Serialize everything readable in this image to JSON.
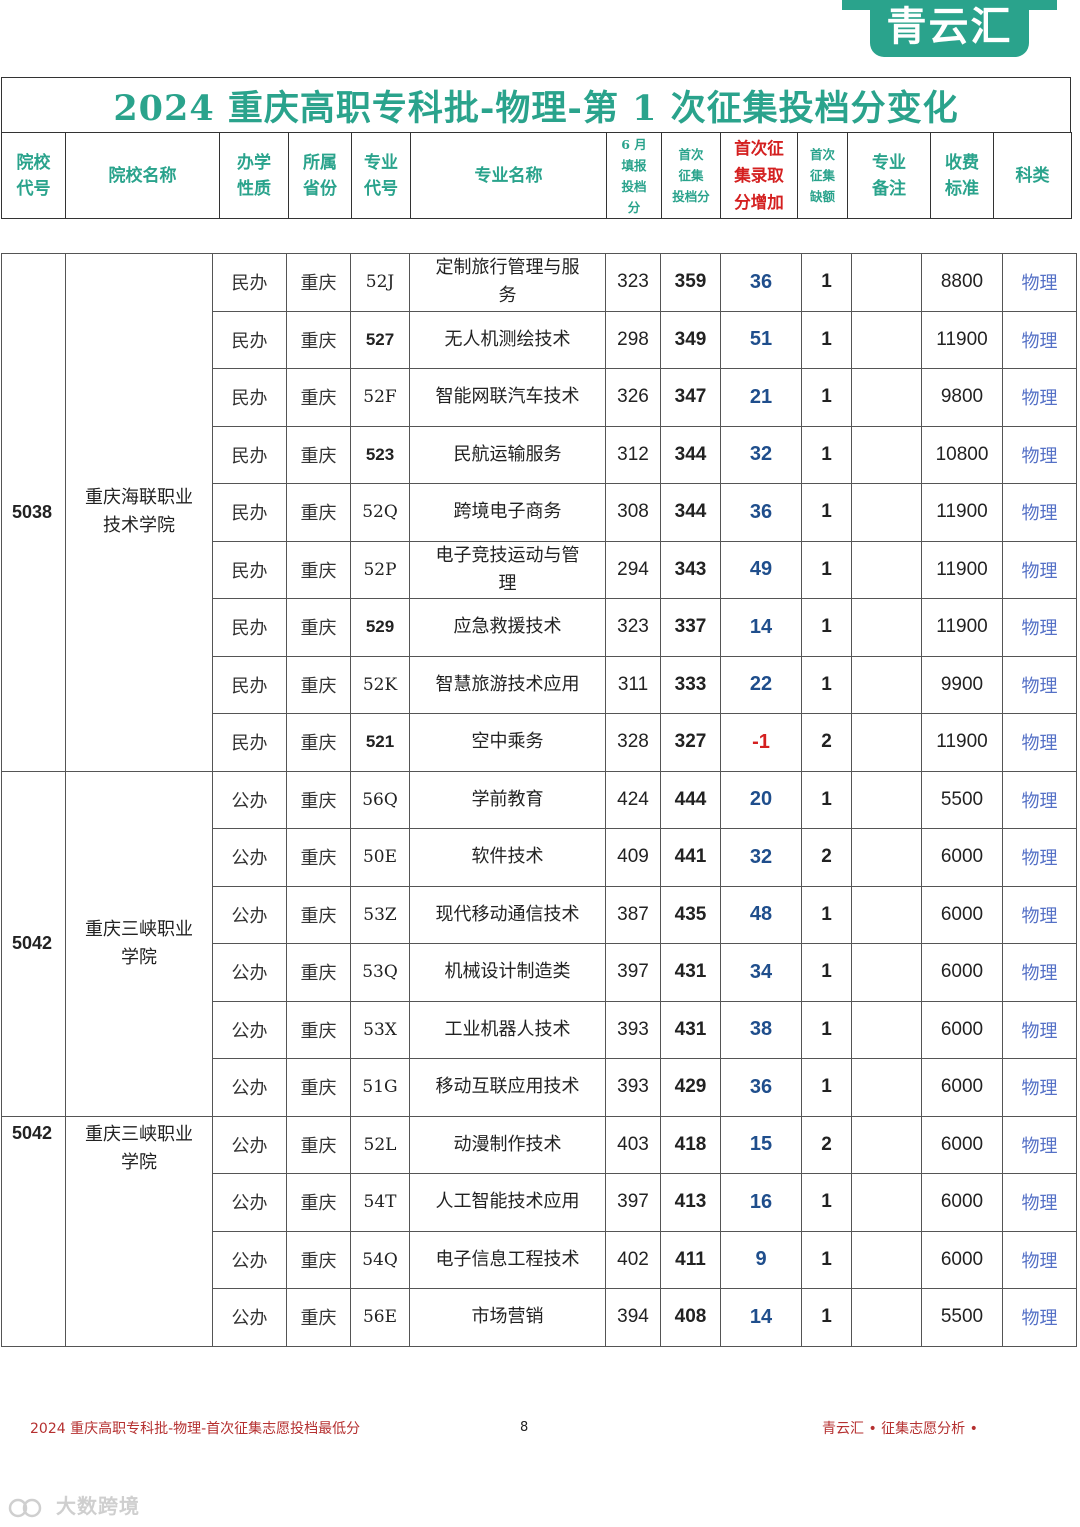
{
  "logo": {
    "text": "青云汇"
  },
  "title": "2024 重庆高职专科批-物理-第 1 次征集投档分变化",
  "colors": {
    "accent": "#2aa38c",
    "highlight_red": "#d42020",
    "increase_blue": "#1f4e8c",
    "category_blue": "#5470c6"
  },
  "header": [
    {
      "text": "院校\n代号",
      "style": "normal"
    },
    {
      "text": "院校名称",
      "style": "normal"
    },
    {
      "text": "办学\n性质",
      "style": "normal"
    },
    {
      "text": "所属\n省份",
      "style": "normal"
    },
    {
      "text": "专业\n代号",
      "style": "normal"
    },
    {
      "text": "专业名称",
      "style": "normal"
    },
    {
      "text": "6 月\n填报\n投档\n分",
      "style": "small"
    },
    {
      "text": "首次\n征集\n投档分",
      "style": "small"
    },
    {
      "text": "首次征\n集录取\n分增加",
      "style": "red"
    },
    {
      "text": "首次\n征集\n缺额",
      "style": "small"
    },
    {
      "text": "专业\n备注",
      "style": "normal"
    },
    {
      "text": "收费\n标准",
      "style": "normal"
    },
    {
      "text": "科类",
      "style": "normal"
    }
  ],
  "groups": [
    {
      "school_code": "5038",
      "school_name": "重庆海联职业\n技术学院",
      "align": "middle",
      "rows": [
        {
          "nature": "民办",
          "province": "重庆",
          "major_code": "52J",
          "bold_code": false,
          "major_name": "定制旅行管理与服\n务",
          "june_score": "323",
          "first_score": "359",
          "increase": "36",
          "gap": "1",
          "note": "",
          "fee": "8800",
          "category": "物理"
        },
        {
          "nature": "民办",
          "province": "重庆",
          "major_code": "527",
          "bold_code": true,
          "major_name": "无人机测绘技术",
          "june_score": "298",
          "first_score": "349",
          "increase": "51",
          "gap": "1",
          "note": "",
          "fee": "11900",
          "category": "物理"
        },
        {
          "nature": "民办",
          "province": "重庆",
          "major_code": "52F",
          "bold_code": false,
          "major_name": "智能网联汽车技术",
          "june_score": "326",
          "first_score": "347",
          "increase": "21",
          "gap": "1",
          "note": "",
          "fee": "9800",
          "category": "物理"
        },
        {
          "nature": "民办",
          "province": "重庆",
          "major_code": "523",
          "bold_code": true,
          "major_name": "民航运输服务",
          "june_score": "312",
          "first_score": "344",
          "increase": "32",
          "gap": "1",
          "note": "",
          "fee": "10800",
          "category": "物理"
        },
        {
          "nature": "民办",
          "province": "重庆",
          "major_code": "52Q",
          "bold_code": false,
          "major_name": "跨境电子商务",
          "june_score": "308",
          "first_score": "344",
          "increase": "36",
          "gap": "1",
          "note": "",
          "fee": "11900",
          "category": "物理"
        },
        {
          "nature": "民办",
          "province": "重庆",
          "major_code": "52P",
          "bold_code": false,
          "major_name": "电子竞技运动与管\n理",
          "june_score": "294",
          "first_score": "343",
          "increase": "49",
          "gap": "1",
          "note": "",
          "fee": "11900",
          "category": "物理"
        },
        {
          "nature": "民办",
          "province": "重庆",
          "major_code": "529",
          "bold_code": true,
          "major_name": "应急救援技术",
          "june_score": "323",
          "first_score": "337",
          "increase": "14",
          "gap": "1",
          "note": "",
          "fee": "11900",
          "category": "物理"
        },
        {
          "nature": "民办",
          "province": "重庆",
          "major_code": "52K",
          "bold_code": false,
          "major_name": "智慧旅游技术应用",
          "june_score": "311",
          "first_score": "333",
          "increase": "22",
          "gap": "1",
          "note": "",
          "fee": "9900",
          "category": "物理"
        },
        {
          "nature": "民办",
          "province": "重庆",
          "major_code": "521",
          "bold_code": true,
          "major_name": "空中乘务",
          "june_score": "328",
          "first_score": "327",
          "increase": "-1",
          "gap": "2",
          "note": "",
          "fee": "11900",
          "category": "物理"
        }
      ]
    },
    {
      "school_code": "5042",
      "school_name": "重庆三峡职业\n学院",
      "align": "middle",
      "rows": [
        {
          "nature": "公办",
          "province": "重庆",
          "major_code": "56Q",
          "bold_code": false,
          "major_name": "学前教育",
          "june_score": "424",
          "first_score": "444",
          "increase": "20",
          "gap": "1",
          "note": "",
          "fee": "5500",
          "category": "物理"
        },
        {
          "nature": "公办",
          "province": "重庆",
          "major_code": "50E",
          "bold_code": false,
          "major_name": "软件技术",
          "june_score": "409",
          "first_score": "441",
          "increase": "32",
          "gap": "2",
          "note": "",
          "fee": "6000",
          "category": "物理"
        },
        {
          "nature": "公办",
          "province": "重庆",
          "major_code": "53Z",
          "bold_code": false,
          "major_name": "现代移动通信技术",
          "june_score": "387",
          "first_score": "435",
          "increase": "48",
          "gap": "1",
          "note": "",
          "fee": "6000",
          "category": "物理"
        },
        {
          "nature": "公办",
          "province": "重庆",
          "major_code": "53Q",
          "bold_code": false,
          "major_name": "机械设计制造类",
          "june_score": "397",
          "first_score": "431",
          "increase": "34",
          "gap": "1",
          "note": "",
          "fee": "6000",
          "category": "物理"
        },
        {
          "nature": "公办",
          "province": "重庆",
          "major_code": "53X",
          "bold_code": false,
          "major_name": "工业机器人技术",
          "june_score": "393",
          "first_score": "431",
          "increase": "38",
          "gap": "1",
          "note": "",
          "fee": "6000",
          "category": "物理"
        },
        {
          "nature": "公办",
          "province": "重庆",
          "major_code": "51G",
          "bold_code": false,
          "major_name": "移动互联应用技术",
          "june_score": "393",
          "first_score": "429",
          "increase": "36",
          "gap": "1",
          "note": "",
          "fee": "6000",
          "category": "物理"
        }
      ]
    },
    {
      "school_code": "5042",
      "school_name": "重庆三峡职业\n学院",
      "align": "top",
      "rows": [
        {
          "nature": "公办",
          "province": "重庆",
          "major_code": "52L",
          "bold_code": false,
          "major_name": "动漫制作技术",
          "june_score": "403",
          "first_score": "418",
          "increase": "15",
          "gap": "2",
          "note": "",
          "fee": "6000",
          "category": "物理"
        },
        {
          "nature": "公办",
          "province": "重庆",
          "major_code": "54T",
          "bold_code": false,
          "major_name": "人工智能技术应用",
          "june_score": "397",
          "first_score": "413",
          "increase": "16",
          "gap": "1",
          "note": "",
          "fee": "6000",
          "category": "物理"
        },
        {
          "nature": "公办",
          "province": "重庆",
          "major_code": "54Q",
          "bold_code": false,
          "major_name": "电子信息工程技术",
          "june_score": "402",
          "first_score": "411",
          "increase": "9",
          "gap": "1",
          "note": "",
          "fee": "6000",
          "category": "物理"
        },
        {
          "nature": "公办",
          "province": "重庆",
          "major_code": "56E",
          "bold_code": false,
          "major_name": "市场营销",
          "june_score": "394",
          "first_score": "408",
          "increase": "14",
          "gap": "1",
          "note": "",
          "fee": "5500",
          "category": "物理"
        }
      ]
    }
  ],
  "footer": {
    "left": "2024 重庆高职专科批-物理-首次征集志愿投档最低分",
    "page": "8",
    "right": "青云汇 • 征集志愿分析 •"
  },
  "watermark": "大数跨境"
}
